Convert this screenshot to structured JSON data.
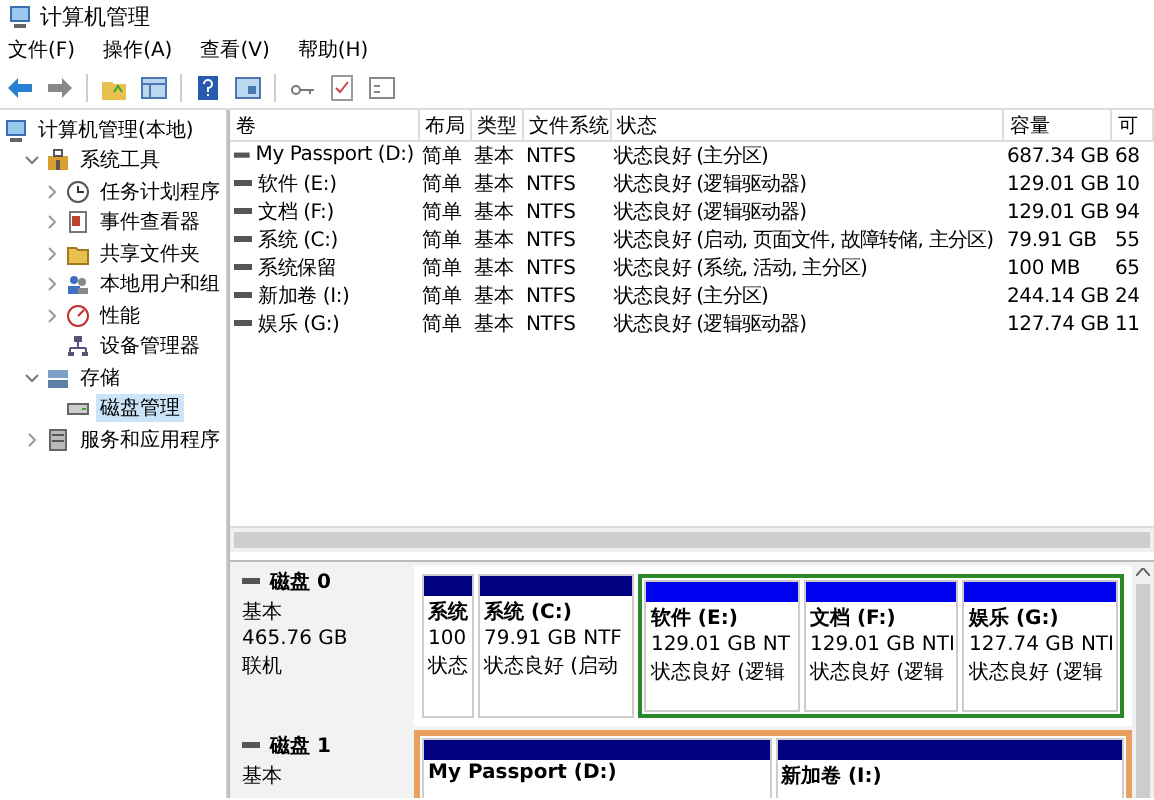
{
  "window": {
    "title": "计算机管理"
  },
  "menu": [
    "文件(F)",
    "操作(A)",
    "查看(V)",
    "帮助(H)"
  ],
  "tree": [
    {
      "label": "计算机管理(本地)",
      "selected": false,
      "children": [
        {
          "label": "系统工具",
          "expanded": true,
          "selected": false,
          "children": [
            {
              "label": "任务计划程序",
              "expanded": false,
              "selected": false
            },
            {
              "label": "事件查看器",
              "expanded": false,
              "selected": false
            },
            {
              "label": "共享文件夹",
              "expanded": false,
              "selected": false
            },
            {
              "label": "本地用户和组",
              "expanded": false,
              "selected": false
            },
            {
              "label": "性能",
              "expanded": false,
              "selected": false
            },
            {
              "label": "设备管理器",
              "selected": false
            }
          ]
        },
        {
          "label": "存储",
          "expanded": true,
          "selected": false,
          "children": [
            {
              "label": "磁盘管理",
              "selected": true
            }
          ]
        },
        {
          "label": "服务和应用程序",
          "expanded": false,
          "selected": false
        }
      ]
    }
  ],
  "table": {
    "columns": [
      "卷",
      "布局",
      "类型",
      "文件系统",
      "状态",
      "容量",
      "可"
    ],
    "rows": [
      [
        "My Passport (D:)",
        "简单",
        "基本",
        "NTFS",
        "状态良好 (主分区)",
        "687.34 GB",
        "68"
      ],
      [
        "软件 (E:)",
        "简单",
        "基本",
        "NTFS",
        "状态良好 (逻辑驱动器)",
        "129.01 GB",
        "10"
      ],
      [
        "文档 (F:)",
        "简单",
        "基本",
        "NTFS",
        "状态良好 (逻辑驱动器)",
        "129.01 GB",
        "94"
      ],
      [
        "系统 (C:)",
        "简单",
        "基本",
        "NTFS",
        "状态良好 (启动, 页面文件, 故障转储, 主分区)",
        "79.91 GB",
        "55"
      ],
      [
        "系统保留",
        "简单",
        "基本",
        "NTFS",
        "状态良好 (系统, 活动, 主分区)",
        "100 MB",
        "65"
      ],
      [
        "新加卷 (I:)",
        "简单",
        "基本",
        "NTFS",
        "状态良好 (主分区)",
        "244.14 GB",
        "24"
      ],
      [
        "娱乐 (G:)",
        "简单",
        "基本",
        "NTFS",
        "状态良好 (逻辑驱动器)",
        "127.74 GB",
        "11"
      ]
    ]
  },
  "disks": [
    {
      "name": "磁盘 0",
      "info": [
        "基本",
        "465.76 GB",
        "联机"
      ],
      "selected": false,
      "partitions": [
        {
          "kind": "primary",
          "lines": [
            "系统",
            "100",
            "状态"
          ]
        },
        {
          "kind": "primary",
          "lines": [
            "系统  (C:)",
            "79.91 GB NTF",
            "状态良好 (启动"
          ]
        },
        {
          "kind": "logical",
          "lines": [
            "软件  (E:)",
            "129.01 GB NT",
            "状态良好 (逻辑"
          ]
        },
        {
          "kind": "logical",
          "lines": [
            "文档  (F:)",
            "129.01 GB NTI",
            "状态良好 (逻辑"
          ]
        },
        {
          "kind": "logical",
          "lines": [
            "娱乐  (G:)",
            "127.74 GB NTI",
            "状态良好 (逻辑"
          ]
        }
      ]
    },
    {
      "name": "磁盘 1",
      "info": [
        "基本"
      ],
      "selected": true,
      "partitions": [
        {
          "kind": "primary",
          "lines": [
            "My Passport  (D:)"
          ]
        },
        {
          "kind": "primary",
          "lines": [
            "新加卷  (I:)"
          ]
        }
      ]
    }
  ]
}
